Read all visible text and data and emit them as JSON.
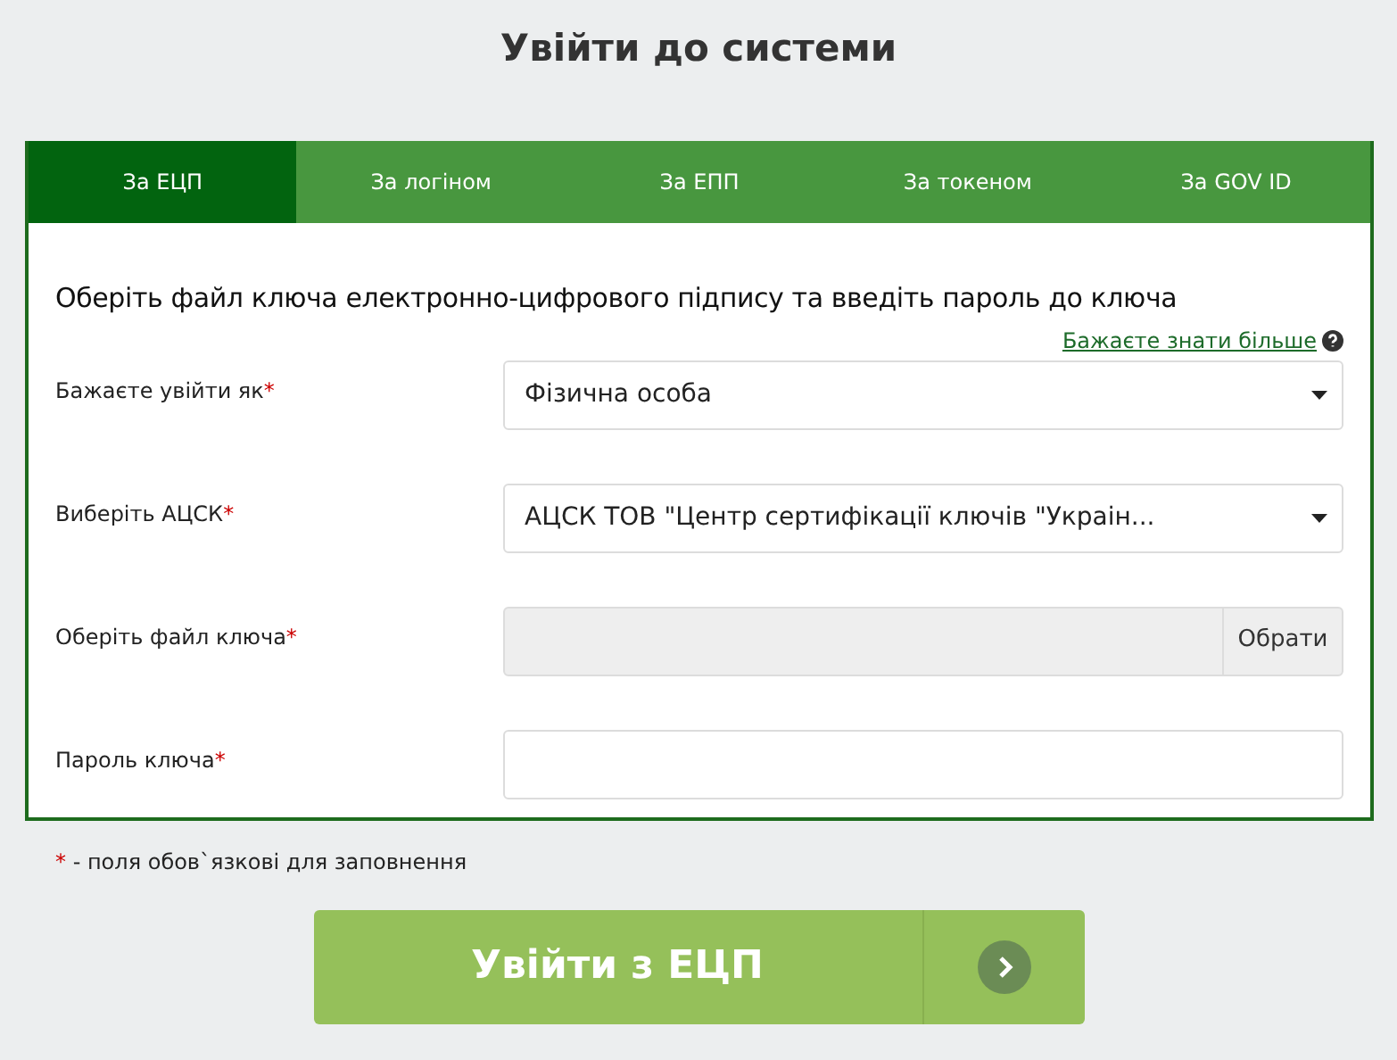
{
  "page_title": "Увійти до системи",
  "tabs": [
    {
      "label": "За ЕЦП",
      "selected": true
    },
    {
      "label": "За логіном",
      "selected": false
    },
    {
      "label": "За ЕПП",
      "selected": false
    },
    {
      "label": "За токеном",
      "selected": false
    },
    {
      "label": "За GOV ID",
      "selected": false
    }
  ],
  "form": {
    "heading": "Оберіть файл ключа електронно-цифрового підпису та введіть пароль до ключа",
    "help_link": "Бажаєте знати більше",
    "fields": [
      {
        "kind": "select",
        "label": "Бажаєте увійти як",
        "required_mark": "*",
        "value": "Фізична особа"
      },
      {
        "kind": "select",
        "label": "Виберіть АЦСК",
        "required_mark": "*",
        "value": "АЦСК ТОВ \"Центр сертифікації ключів \"Украін..."
      },
      {
        "kind": "file",
        "label": "Оберіть файл ключа",
        "required_mark": "*",
        "button": "Обрати"
      },
      {
        "kind": "password",
        "label": "Пароль ключа",
        "required_mark": "*"
      }
    ]
  },
  "footnote": {
    "mark": "*",
    "text": " - поля обов`язкові для заповнення"
  },
  "submit_button": "Увійти з ЕЦП"
}
